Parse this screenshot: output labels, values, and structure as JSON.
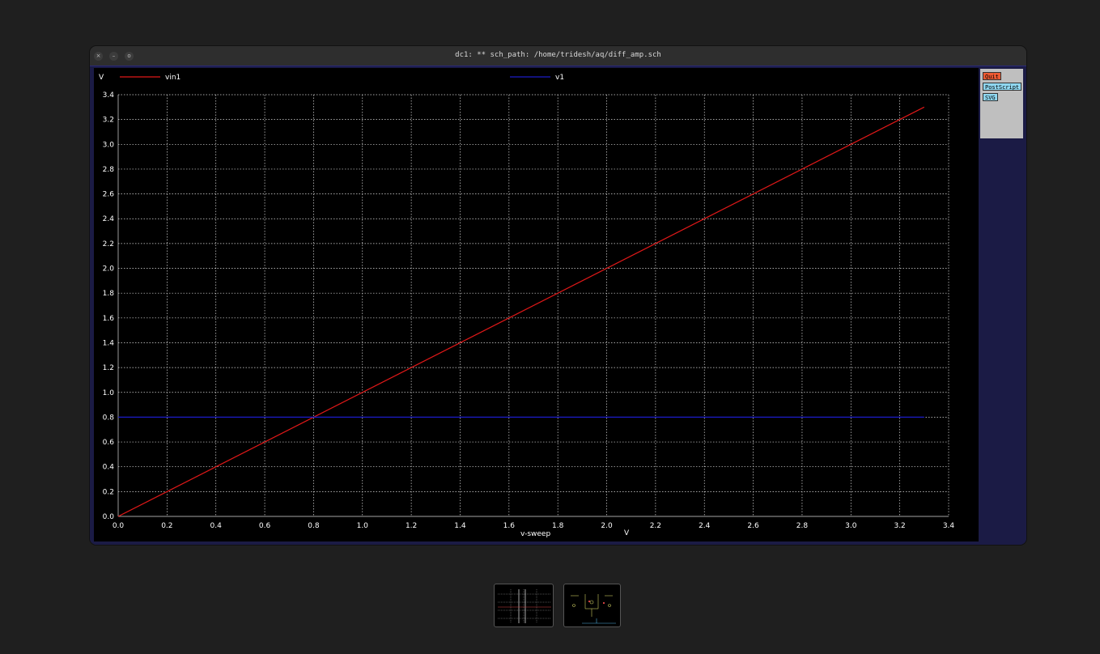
{
  "window": {
    "title": "dc1: ** sch_path: /home/tridesh/aq/diff_amp.sch",
    "close_glyph": "×",
    "minimize_glyph": "–",
    "maximize_glyph": "o"
  },
  "side_panel": {
    "quit_label": "Quit",
    "postscript_label": "PostScript",
    "svg_label": "SVG"
  },
  "colors": {
    "background": "#000000",
    "grid": "#dcdcdc",
    "axis_text": "#ffffff",
    "vin1": "#e01818",
    "v1": "#1c1cc8",
    "quit_button": "#ee5a32",
    "export_button": "#8fd7f0"
  },
  "chart_data": {
    "type": "line",
    "ylabel_unit": "V",
    "xlabel": "v-sweep",
    "xlabel_unit": "V",
    "xlim": [
      0.0,
      3.4
    ],
    "ylim": [
      0.0,
      3.4
    ],
    "xticks": [
      "0.0",
      "0.2",
      "0.4",
      "0.6",
      "0.8",
      "1.0",
      "1.2",
      "1.4",
      "1.6",
      "1.8",
      "2.0",
      "2.2",
      "2.4",
      "2.6",
      "2.8",
      "3.0",
      "3.2",
      "3.4"
    ],
    "yticks": [
      "0.0",
      "0.2",
      "0.4",
      "0.6",
      "0.8",
      "1.0",
      "1.2",
      "1.4",
      "1.6",
      "1.8",
      "2.0",
      "2.2",
      "2.4",
      "2.6",
      "2.8",
      "3.0",
      "3.2",
      "3.4"
    ],
    "grid": true,
    "legend_placement": "top",
    "series": [
      {
        "name": "vin1",
        "x": [
          0.0,
          3.3
        ],
        "y": [
          0.0,
          3.3
        ]
      },
      {
        "name": "v1",
        "x": [
          0.0,
          3.3
        ],
        "y": [
          0.8,
          0.8
        ]
      }
    ]
  },
  "taskbar": {
    "thumbnails": [
      "waveform-window-thumbnail",
      "schematic-window-thumbnail"
    ]
  }
}
